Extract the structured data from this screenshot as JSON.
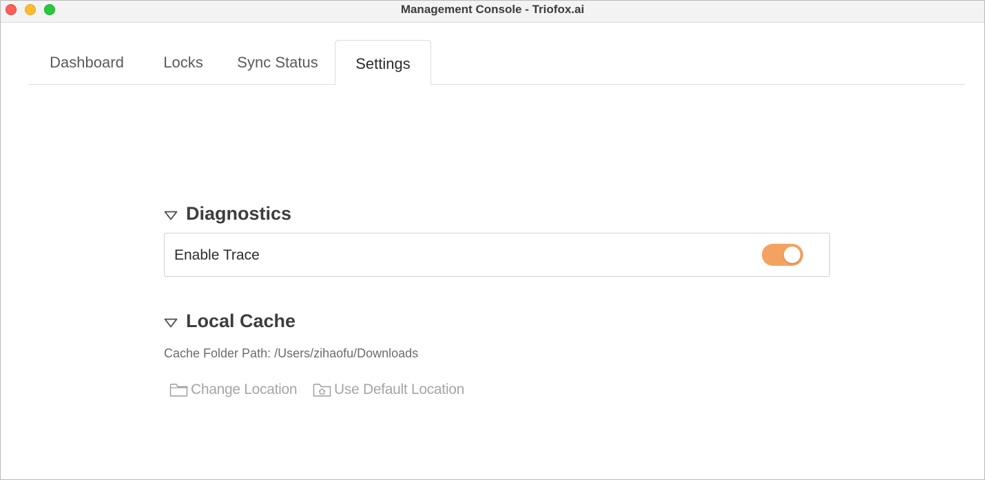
{
  "window": {
    "title": "Management Console - Triofox.ai"
  },
  "tabs": [
    {
      "label": "Dashboard",
      "active": false
    },
    {
      "label": "Locks",
      "active": false
    },
    {
      "label": "Sync Status",
      "active": false
    },
    {
      "label": "Settings",
      "active": true
    }
  ],
  "diagnostics": {
    "title": "Diagnostics",
    "enable_trace_label": "Enable Trace",
    "enable_trace_on": true,
    "toggle_color": "#f4a261"
  },
  "local_cache": {
    "title": "Local Cache",
    "cache_path_text": "Cache Folder Path: /Users/zihaofu/Downloads",
    "change_location_label": "Change Location",
    "change_location_icon": "folder-icon",
    "default_location_label": "Use Default Location",
    "default_location_icon": "home-folder-icon"
  }
}
